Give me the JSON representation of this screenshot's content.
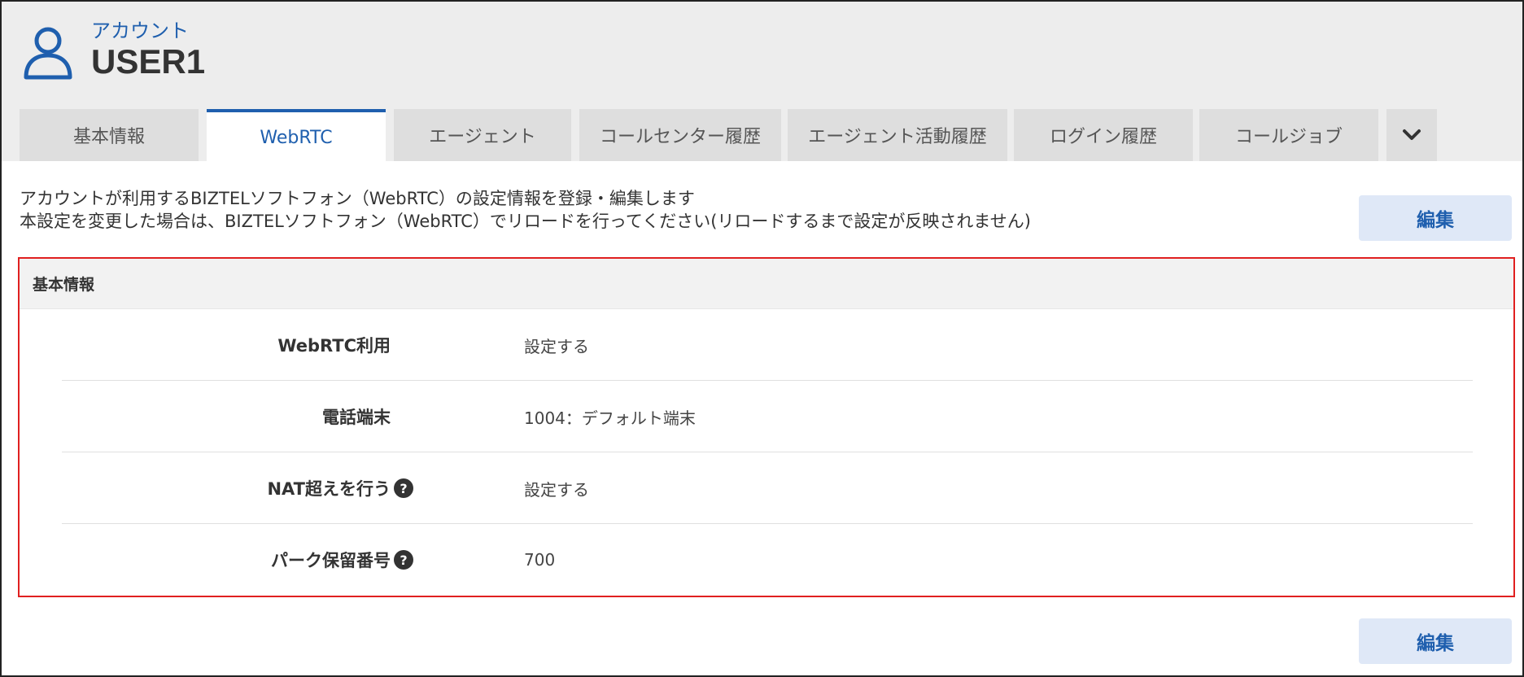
{
  "header": {
    "account_label": "アカウント",
    "user_name": "USER1"
  },
  "tabs": [
    {
      "label": "基本情報",
      "active": false
    },
    {
      "label": "WebRTC",
      "active": true
    },
    {
      "label": "エージェント",
      "active": false
    },
    {
      "label": "コールセンター履歴",
      "active": false
    },
    {
      "label": "エージェント活動履歴",
      "active": false
    },
    {
      "label": "ログイン履歴",
      "active": false
    },
    {
      "label": "コールジョブ",
      "active": false
    }
  ],
  "tab_more_icon": "chevron-down-icon",
  "description": {
    "line1": "アカウントが利用するBIZTELソフトフォン（WebRTC）の設定情報を登録・編集します",
    "line2": "本設定を変更した場合は、BIZTELソフトフォン（WebRTC）でリロードを行ってください(リロードするまで設定が反映されません)"
  },
  "edit_button_label": "編集",
  "panel": {
    "title": "基本情報",
    "rows": [
      {
        "label": "WebRTC利用",
        "value": "設定する",
        "help": false
      },
      {
        "label": "電話端末",
        "value": "1004：デフォルト端末",
        "help": false
      },
      {
        "label": "NAT超えを行う",
        "value": "設定する",
        "help": true
      },
      {
        "label": "パーク保留番号",
        "value": "700",
        "help": true
      }
    ]
  },
  "colors": {
    "accent": "#1f5fae",
    "highlight_border": "#e02020",
    "button_bg": "#dfe8f7"
  }
}
